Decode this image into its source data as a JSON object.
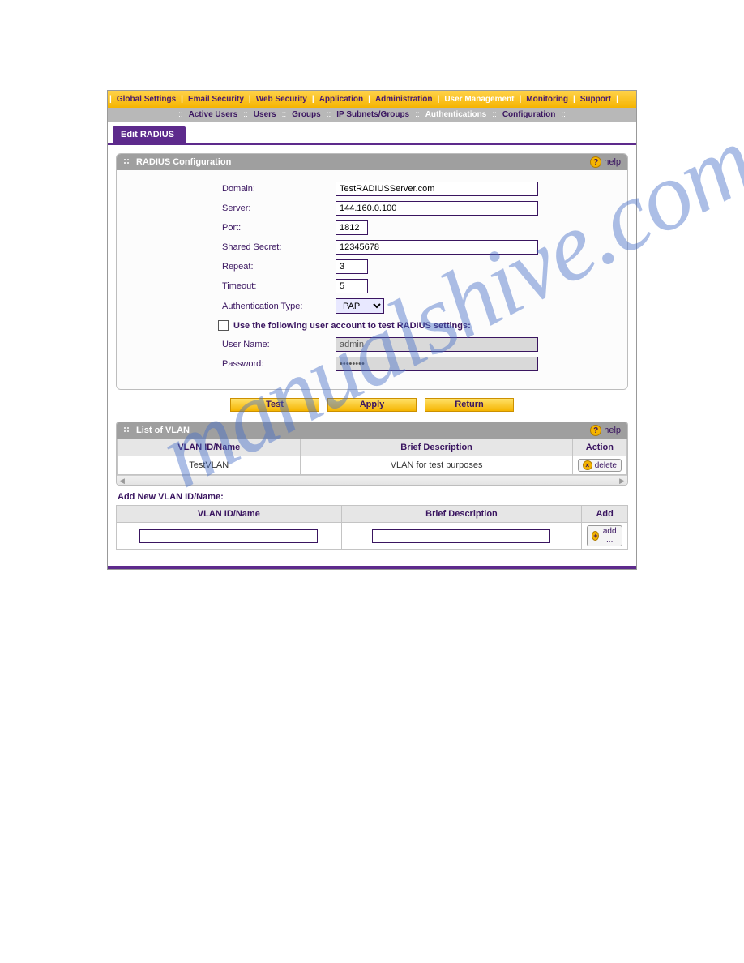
{
  "watermark": "manualshive.com",
  "topnav": {
    "items": [
      "Global Settings",
      "Email Security",
      "Web Security",
      "Application",
      "Administration",
      "User Management",
      "Monitoring",
      "Support"
    ],
    "active_index": 5
  },
  "subnav": {
    "items": [
      "Active Users",
      "Users",
      "Groups",
      "IP Subnets/Groups",
      "Authentications",
      "Configuration"
    ],
    "active_index": 4
  },
  "tab": {
    "label": "Edit RADIUS"
  },
  "radius_panel": {
    "title": "RADIUS Configuration",
    "help": "help",
    "labels": {
      "domain": "Domain:",
      "server": "Server:",
      "port": "Port:",
      "shared_secret": "Shared Secret:",
      "repeat": "Repeat:",
      "timeout": "Timeout:",
      "auth_type": "Authentication Type:",
      "test_account": "Use the following user account to test RADIUS settings:",
      "username": "User Name:",
      "password": "Password:"
    },
    "values": {
      "domain": "TestRADIUSServer.com",
      "server": "144.160.0.100",
      "port": "1812",
      "shared_secret": "12345678",
      "repeat": "3",
      "timeout": "5",
      "auth_type": "PAP",
      "username": "admin",
      "password": "••••••••"
    }
  },
  "buttons": {
    "test": "Test",
    "apply": "Apply",
    "return": "Return"
  },
  "vlan_panel": {
    "title": "List of VLAN",
    "help": "help",
    "headers": {
      "id": "VLAN ID/Name",
      "desc": "Brief Description",
      "action": "Action"
    },
    "rows": [
      {
        "id": "TestVLAN",
        "desc": "VLAN for test purposes",
        "action": "delete"
      }
    ]
  },
  "add_vlan": {
    "section": "Add New VLAN ID/Name:",
    "headers": {
      "id": "VLAN ID/Name",
      "desc": "Brief Description",
      "add": "Add"
    },
    "button": "add ..."
  }
}
